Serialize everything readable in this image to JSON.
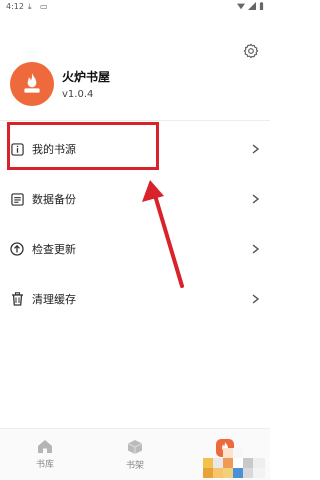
{
  "status_bar": {
    "time": "4:12"
  },
  "profile": {
    "app_name": "火炉书屋",
    "version": "v1.0.4"
  },
  "menu": {
    "items": [
      {
        "label": "我的书源",
        "icon": "info-icon"
      },
      {
        "label": "数据备份",
        "icon": "document-icon"
      },
      {
        "label": "检查更新",
        "icon": "arrow-up-circle-icon"
      },
      {
        "label": "清理缓存",
        "icon": "trash-icon"
      }
    ]
  },
  "bottom_nav": {
    "items": [
      {
        "label": "书库",
        "icon": "home-icon"
      },
      {
        "label": "书架",
        "icon": "cube-icon"
      },
      {
        "label": "",
        "icon": "app-logo-icon"
      }
    ]
  },
  "colors": {
    "brand": "#ee6a3c",
    "highlight": "#d8232a",
    "text": "#222222",
    "muted": "#888888"
  }
}
